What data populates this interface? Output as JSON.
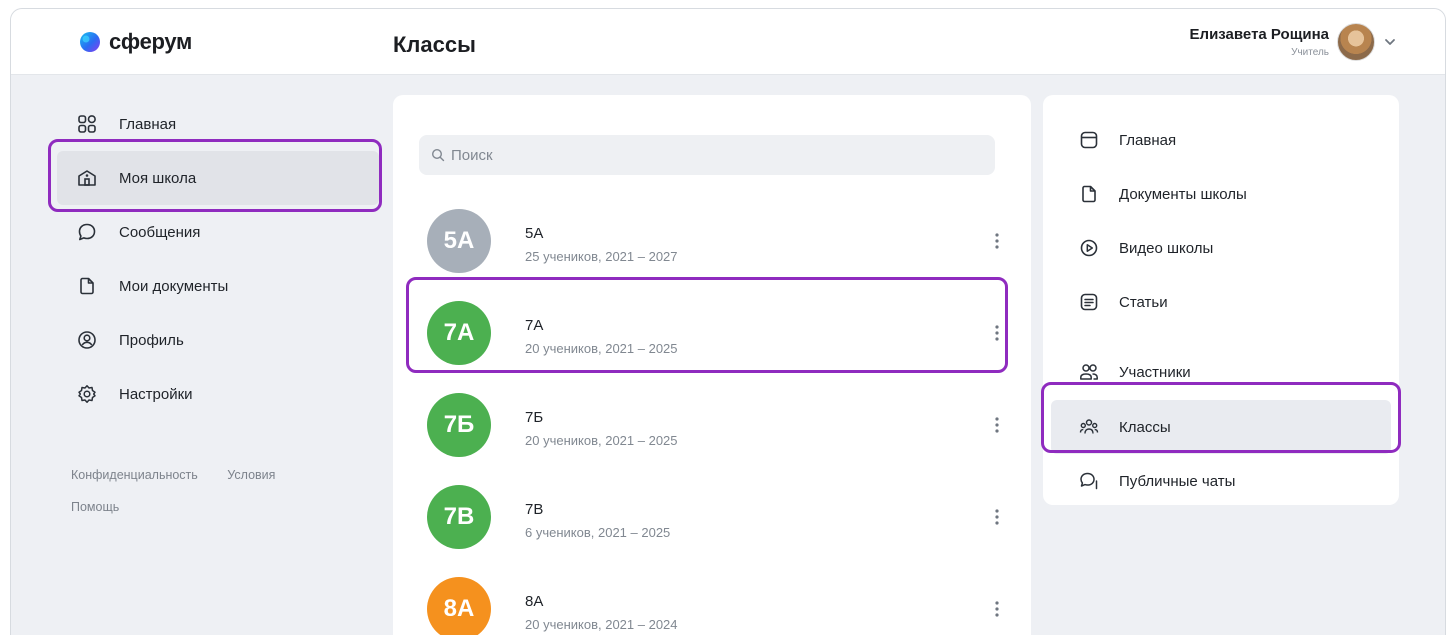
{
  "app": {
    "logo_text": "сферум",
    "page_title": "Классы"
  },
  "user": {
    "name": "Елизавета Рощина",
    "role": "Учитель"
  },
  "sidebar": {
    "items": [
      {
        "label": "Главная",
        "icon": "grid-icon"
      },
      {
        "label": "Моя школа",
        "icon": "school-icon",
        "active": true
      },
      {
        "label": "Сообщения",
        "icon": "chat-bubble-icon"
      },
      {
        "label": "Мои документы",
        "icon": "document-icon"
      },
      {
        "label": "Профиль",
        "icon": "profile-icon"
      },
      {
        "label": "Настройки",
        "icon": "gear-icon"
      }
    ],
    "footer": {
      "privacy": "Конфиденциальность",
      "terms": "Условия",
      "help": "Помощь"
    }
  },
  "search": {
    "placeholder": "Поиск"
  },
  "classes": [
    {
      "badge": "5А",
      "name": "5А",
      "details": "25 учеников, 2021 – 2027",
      "color": "#a7afb9"
    },
    {
      "badge": "7А",
      "name": "7А",
      "details": "20 учеников, 2021 – 2025",
      "color": "#4cb050"
    },
    {
      "badge": "7Б",
      "name": "7Б",
      "details": "20 учеников, 2021 – 2025",
      "color": "#4cb050"
    },
    {
      "badge": "7В",
      "name": "7В",
      "details": "6 учеников, 2021 – 2025",
      "color": "#4cb050"
    },
    {
      "badge": "8А",
      "name": "8А",
      "details": "20 учеников, 2021 – 2024",
      "color": "#f5911e"
    }
  ],
  "school_menu": {
    "items": [
      {
        "label": "Главная",
        "icon": "home-card-icon"
      },
      {
        "label": "Документы школы",
        "icon": "document-icon"
      },
      {
        "label": "Видео школы",
        "icon": "play-icon"
      },
      {
        "label": "Статьи",
        "icon": "article-icon"
      },
      {
        "label": "Участники",
        "icon": "people-icon"
      },
      {
        "label": "Классы",
        "icon": "classes-icon",
        "active": true
      },
      {
        "label": "Публичные чаты",
        "icon": "public-chat-icon"
      }
    ]
  },
  "colors": {
    "highlight": "#8f2bbf",
    "brand_blue": "#2787f5",
    "brand_purple": "#7a4af0"
  }
}
